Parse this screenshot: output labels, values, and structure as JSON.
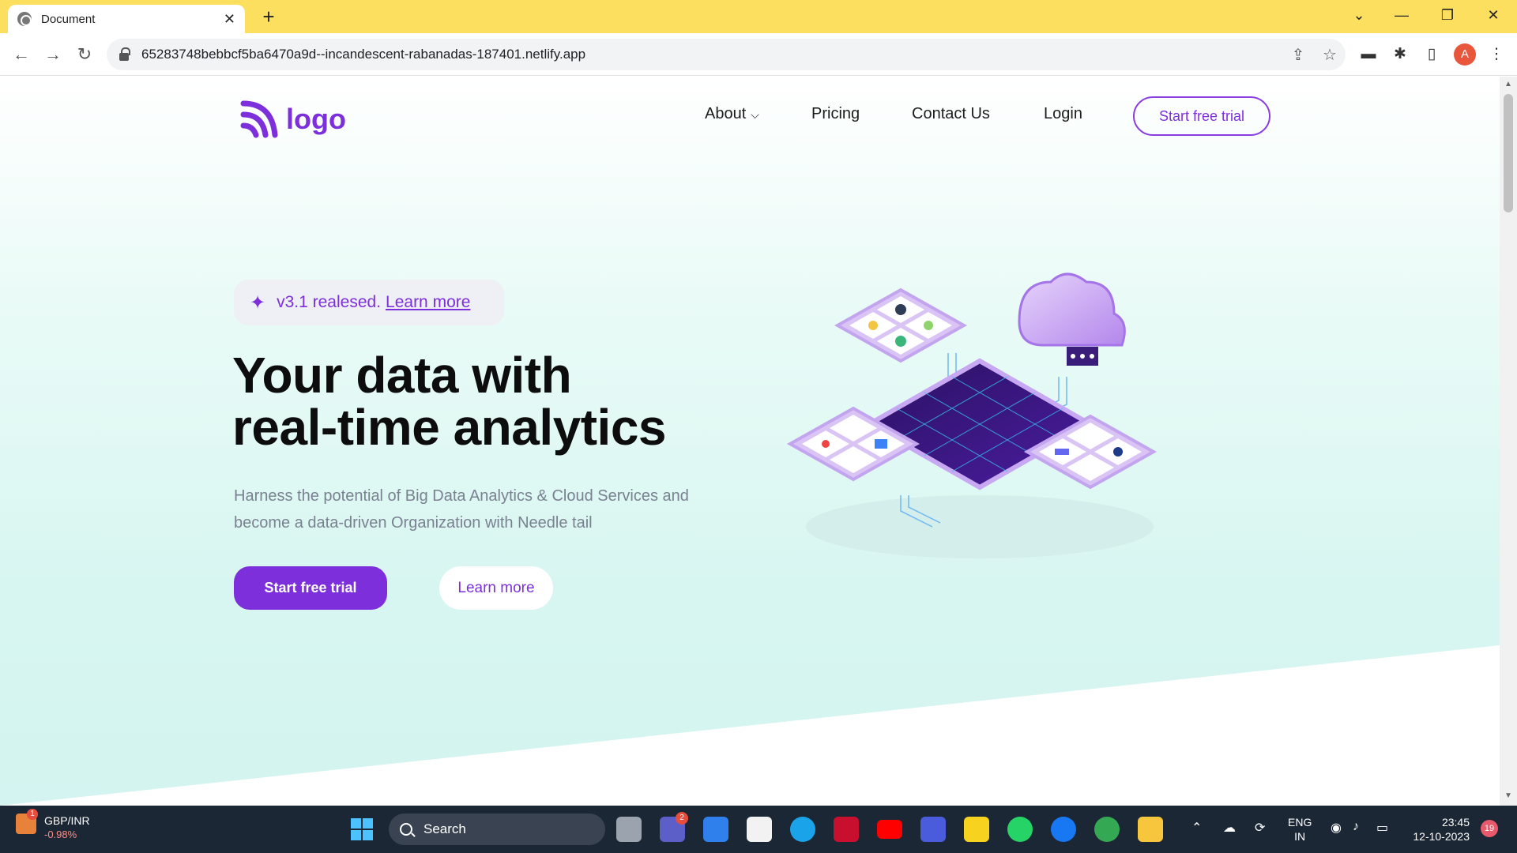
{
  "browser": {
    "tab_title": "Document",
    "tab_close": "✕",
    "new_tab": "+",
    "url": "65283748bebbcf5ba6470a9d--incandescent-rabanadas-187401.netlify.app",
    "profile_initial": "A"
  },
  "site": {
    "logo_text": "logo",
    "nav": {
      "about": "About",
      "pricing": "Pricing",
      "contact": "Contact Us",
      "login": "Login",
      "cta": "Start free trial"
    },
    "badge": {
      "text": "v3.1 realesed.",
      "link": "Learn more"
    },
    "headline_line1": "Your data with",
    "headline_line2": "real-time analytics",
    "subtitle": "Harness the potential of Big Data Analytics & Cloud Services and become a data-driven Organization with Needle tail",
    "primary_button": "Start free trial",
    "secondary_button": "Learn more"
  },
  "taskbar": {
    "ticker_pair": "GBP/INR",
    "ticker_change": "-0.98%",
    "ticker_badge": "1",
    "search_label": "Search",
    "chat_badge": "2",
    "lang_line1": "ENG",
    "lang_line2": "IN",
    "time": "23:45",
    "date": "12-10-2023",
    "notif_count": "19"
  },
  "colors": {
    "brand": "#7c2fdb",
    "tabbar": "#fddf5f",
    "taskbar": "#1c2736"
  }
}
